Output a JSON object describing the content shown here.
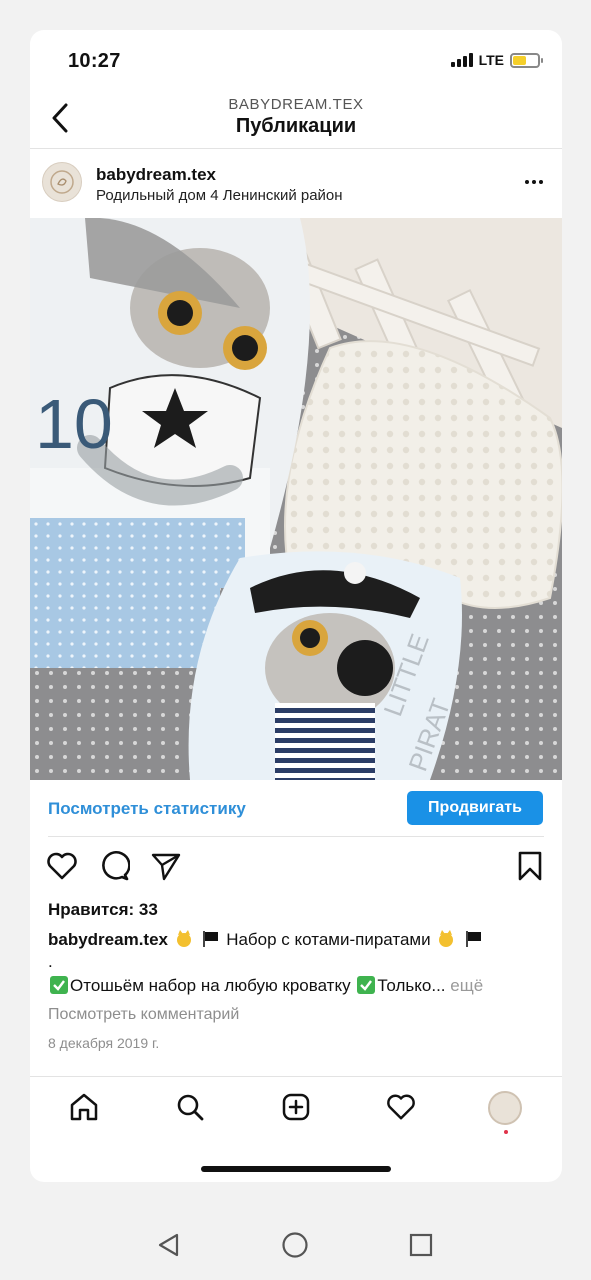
{
  "status_bar": {
    "time": "10:27",
    "network": "LTE",
    "battery_level": 0.55
  },
  "header": {
    "subtitle": "BABYDREAM.TEX",
    "title": "Публикации"
  },
  "post": {
    "username": "babydream.tex",
    "location": "Родильный дом 4 Ленинский район",
    "photo_alt": "",
    "insights_link": "Посмотреть статистику",
    "promote_label": "Продвигать",
    "likes": "Нравится: 33",
    "caption_username": "babydream.tex",
    "caption_line1": "Набор с котами-пиратами",
    "caption_dot": ".",
    "caption_line2": "Отошьём набор на любую кроватку",
    "caption_line2_tail": "Только...",
    "more_label": "ещё",
    "comments_link": "Посмотреть комментарий",
    "date": "8 декабря 2019 г."
  },
  "icons": {
    "back": "chevron-left-icon",
    "more": "more-horizontal-icon",
    "like": "heart-icon",
    "comment": "comment-icon",
    "share": "send-icon",
    "save": "bookmark-icon",
    "home": "home-icon",
    "search": "search-icon",
    "create": "plus-square-icon",
    "activity": "heart-icon",
    "profile": "avatar"
  },
  "colors": {
    "accent": "#1a91e6",
    "link": "#2f8fd8",
    "notification": "#e0334a"
  }
}
